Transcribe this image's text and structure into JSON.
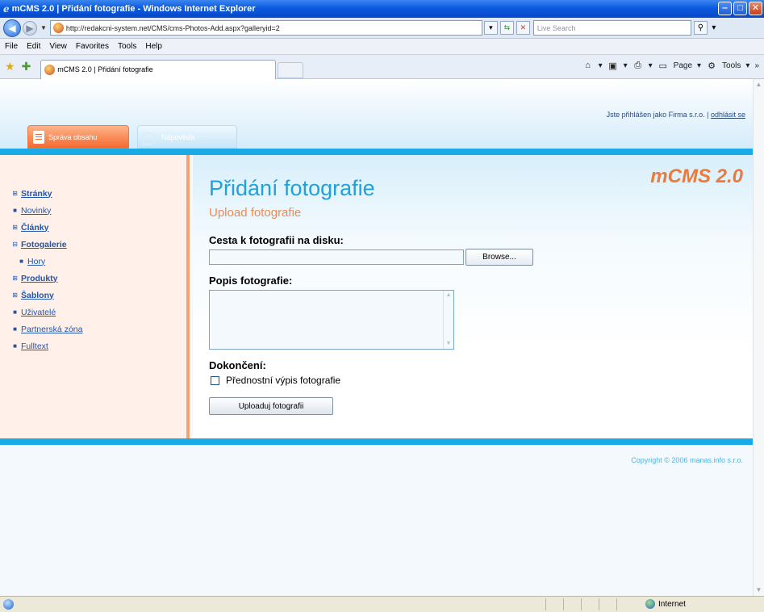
{
  "window": {
    "title": "mCMS 2.0 | Přidání fotografie - Windows Internet Explorer",
    "url": "http://redakcni-system.net/CMS/cms-Photos-Add.aspx?galleryid=2",
    "search_placeholder": "Live Search",
    "menu": [
      "File",
      "Edit",
      "View",
      "Favorites",
      "Tools",
      "Help"
    ],
    "tab_title": "mCMS 2.0 | Přidání fotografie",
    "cmd_page": "Page",
    "cmd_tools": "Tools"
  },
  "header": {
    "login_text": "Jste přihlášen jako Firma s.r.o. | ",
    "logout_link": "odhlásit se",
    "tabs": [
      {
        "label": "Správa obsahu",
        "active": true
      },
      {
        "label": "Nápověda",
        "active": false
      }
    ]
  },
  "sidebar": {
    "items": [
      {
        "label": "Stránky",
        "marker": "⊞",
        "bold": true,
        "sub": false
      },
      {
        "label": "Novinky",
        "marker": "■",
        "bold": false,
        "sub": false
      },
      {
        "label": "Články",
        "marker": "⊞",
        "bold": true,
        "sub": false
      },
      {
        "label": "Fotogalerie",
        "marker": "⊟",
        "bold": true,
        "sub": false
      },
      {
        "label": "Hory",
        "marker": "■",
        "bold": false,
        "sub": true
      },
      {
        "label": "Produkty",
        "marker": "⊞",
        "bold": true,
        "sub": false
      },
      {
        "label": "Šablony",
        "marker": "⊞",
        "bold": true,
        "sub": false
      },
      {
        "label": "Uživatelé",
        "marker": "■",
        "bold": false,
        "sub": false
      },
      {
        "label": "Partnerská zóna",
        "marker": "■",
        "bold": false,
        "sub": false
      },
      {
        "label": "Fulltext",
        "marker": "■",
        "bold": false,
        "sub": false
      }
    ]
  },
  "content": {
    "brand": "mCMS 2.0",
    "title": "Přidání fotografie",
    "subtitle": "Upload fotografie",
    "file_label": "Cesta k fotografii na disku:",
    "browse_button": "Browse...",
    "description_label": "Popis fotografie:",
    "finish_label": "Dokončení:",
    "priority_checkbox": "Přednostní výpis fotografie",
    "submit_button": "Uploaduj fotografii"
  },
  "footer": {
    "copyright": "Copyright © 2006 manas.info s.r.o."
  },
  "status": {
    "zone": "Internet"
  },
  "colors": {
    "accent_blue": "#1aaae6",
    "accent_orange": "#f36a2e",
    "link": "#2255a8"
  }
}
